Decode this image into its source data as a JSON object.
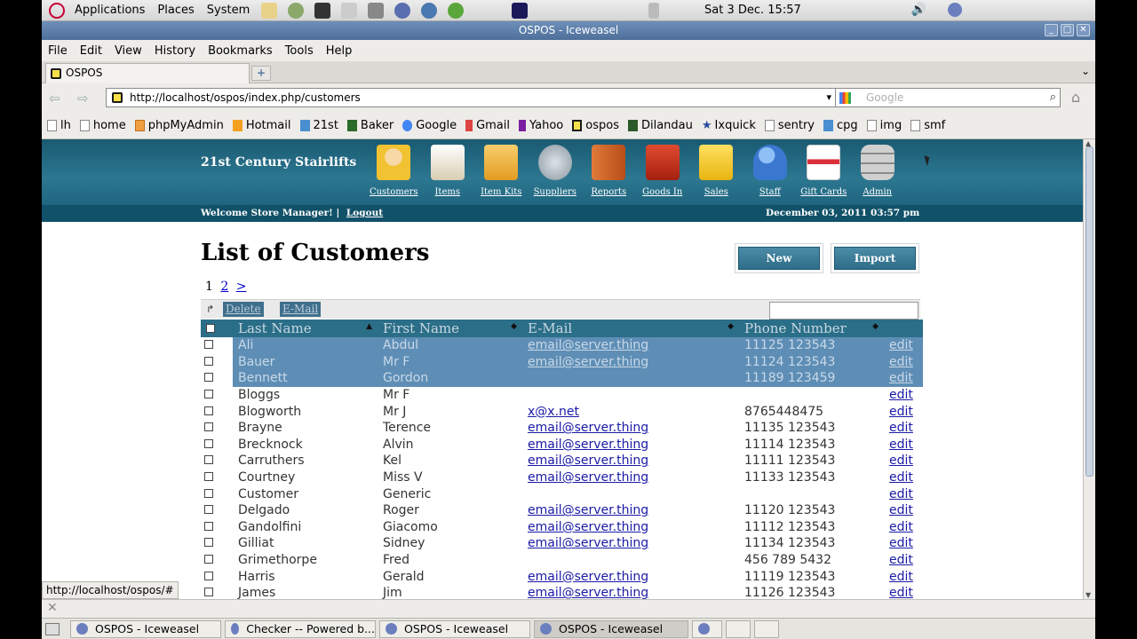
{
  "gnome_panel": {
    "menus": [
      "Applications",
      "Places",
      "System"
    ],
    "clock": "Sat  3 Dec. 15:57"
  },
  "window": {
    "title": "OSPOS - Iceweasel",
    "menubar": [
      "File",
      "Edit",
      "View",
      "History",
      "Bookmarks",
      "Tools",
      "Help"
    ],
    "tab_label": "OSPOS",
    "url": "http://localhost/ospos/index.php/customers",
    "search_placeholder": "Google",
    "bookmarks": [
      "lh",
      "home",
      "phpMyAdmin",
      "Hotmail",
      "21st",
      "Baker",
      "Google",
      "Gmail",
      "Yahoo",
      "ospos",
      "Dilandau",
      "Ixquick",
      "sentry",
      "cpg",
      "img",
      "smf"
    ],
    "status_url": "http://localhost/ospos/#"
  },
  "app": {
    "company": "21st Century Stairlifts",
    "modules": [
      {
        "label": "Customers",
        "icon": "customers-icon",
        "color": "#f1c232"
      },
      {
        "label": "Items",
        "icon": "items-icon",
        "color": "#e9dfc8"
      },
      {
        "label": "Item Kits",
        "icon": "item-kits-icon",
        "color": "#f0b53e"
      },
      {
        "label": "Suppliers",
        "icon": "suppliers-icon",
        "color": "#b9c4cc"
      },
      {
        "label": "Reports",
        "icon": "reports-icon",
        "color": "#d56a2a"
      },
      {
        "label": "Goods In",
        "icon": "goods-in-icon",
        "color": "#c8321e"
      },
      {
        "label": "Sales",
        "icon": "sales-icon",
        "color": "#f3c920"
      },
      {
        "label": "Staff",
        "icon": "staff-icon",
        "color": "#4c86d9"
      },
      {
        "label": "Gift Cards",
        "icon": "gift-cards-icon",
        "color": "#e8e2e2"
      },
      {
        "label": "Admin",
        "icon": "admin-icon",
        "color": "#a7a7a7"
      }
    ],
    "welcome": "Welcome Store Manager!",
    "logout": "Logout",
    "date": "December 03, 2011 03:57 pm",
    "page_title": "List of Customers",
    "new_button": "New",
    "import_button": "Import",
    "pager": {
      "current": "1",
      "next_page": "2",
      "next_arrow": ">"
    },
    "delete_button": "Delete",
    "email_button": "E-Mail",
    "columns": [
      "Last Name",
      "First Name",
      "E-Mail",
      "Phone Number"
    ],
    "edit_label": "edit",
    "rows": [
      {
        "last": "Ali",
        "first": "Abdul",
        "email": "email@server.thing",
        "phone": "11125 123543",
        "selected": true
      },
      {
        "last": "Bauer",
        "first": "Mr F",
        "email": "email@server.thing",
        "phone": "11124 123543",
        "selected": true
      },
      {
        "last": "Bennett",
        "first": "Gordon",
        "email": "",
        "phone": "11189 123459",
        "selected": true
      },
      {
        "last": "Bloggs",
        "first": "Mr F",
        "email": "",
        "phone": "",
        "selected": false
      },
      {
        "last": "Blogworth",
        "first": "Mr J",
        "email": "x@x.net",
        "phone": "8765448475",
        "selected": false
      },
      {
        "last": "Brayne",
        "first": "Terence",
        "email": "email@server.thing",
        "phone": "11135 123543",
        "selected": false
      },
      {
        "last": "Brecknock",
        "first": "Alvin",
        "email": "email@server.thing",
        "phone": "11114 123543",
        "selected": false
      },
      {
        "last": "Carruthers",
        "first": "Kel",
        "email": "email@server.thing",
        "phone": "11111 123543",
        "selected": false
      },
      {
        "last": "Courtney",
        "first": "Miss V",
        "email": "email@server.thing",
        "phone": "11133 123543",
        "selected": false
      },
      {
        "last": "Customer",
        "first": "Generic",
        "email": "",
        "phone": "",
        "selected": false
      },
      {
        "last": "Delgado",
        "first": "Roger",
        "email": "email@server.thing",
        "phone": "11120 123543",
        "selected": false
      },
      {
        "last": "Gandolfini",
        "first": "Giacomo",
        "email": "email@server.thing",
        "phone": "11112 123543",
        "selected": false
      },
      {
        "last": "Gilliat",
        "first": "Sidney",
        "email": "email@server.thing",
        "phone": "11134 123543",
        "selected": false
      },
      {
        "last": "Grimethorpe",
        "first": "Fred",
        "email": "",
        "phone": "456 789 5432",
        "selected": false
      },
      {
        "last": "Harris",
        "first": "Gerald",
        "email": "email@server.thing",
        "phone": "11119 123543",
        "selected": false
      },
      {
        "last": "James",
        "first": "Jim",
        "email": "email@server.thing",
        "phone": "11126 123543",
        "selected": false
      }
    ]
  },
  "taskbar": {
    "tasks": [
      "OSPOS - Iceweasel",
      "Checker -- Powered b...",
      "OSPOS - Iceweasel",
      "OSPOS - Iceweasel"
    ]
  }
}
